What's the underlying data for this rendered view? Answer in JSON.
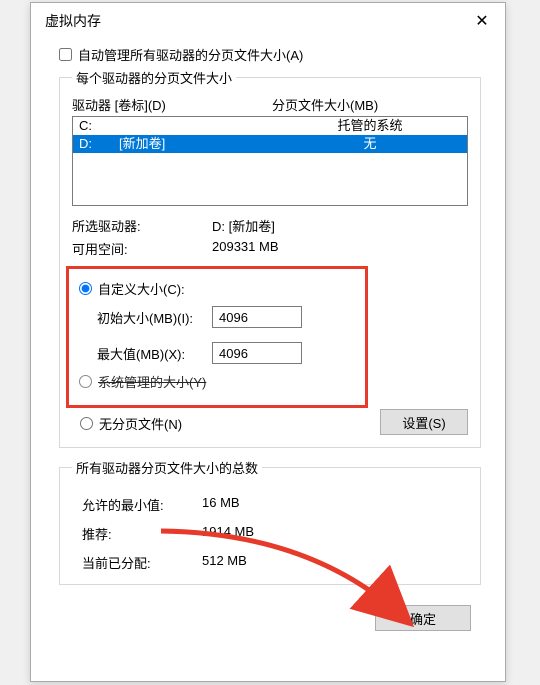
{
  "title": "虚拟内存",
  "auto_manage_label": "自动管理所有驱动器的分页文件大小(A)",
  "auto_manage_checked": false,
  "per_drive": {
    "legend": "每个驱动器的分页文件大小",
    "col_drive": "驱动器 [卷标](D)",
    "col_pagefile": "分页文件大小(MB)",
    "rows": [
      {
        "letter": "C:",
        "label": "",
        "pagefile": "托管的系统",
        "selected": false
      },
      {
        "letter": "D:",
        "label": "[新加卷]",
        "pagefile": "无",
        "selected": true
      }
    ],
    "selected_drive_label": "所选驱动器:",
    "selected_drive_value": "D:  [新加卷]",
    "free_space_label": "可用空间:",
    "free_space_value": "209331 MB",
    "custom_label": "自定义大小(C):",
    "initial_label": "初始大小(MB)(I):",
    "initial_value": "4096",
    "max_label": "最大值(MB)(X):",
    "max_value": "4096",
    "system_managed_label": "系统管理的大小(Y)",
    "no_pagefile_label": "无分页文件(N)",
    "set_button": "设置(S)"
  },
  "totals": {
    "legend": "所有驱动器分页文件大小的总数",
    "min_label": "允许的最小值:",
    "min_value": "16 MB",
    "rec_label": "推荐:",
    "rec_value": "1914 MB",
    "cur_label": "当前已分配:",
    "cur_value": "512 MB"
  },
  "ok_button": "确定"
}
